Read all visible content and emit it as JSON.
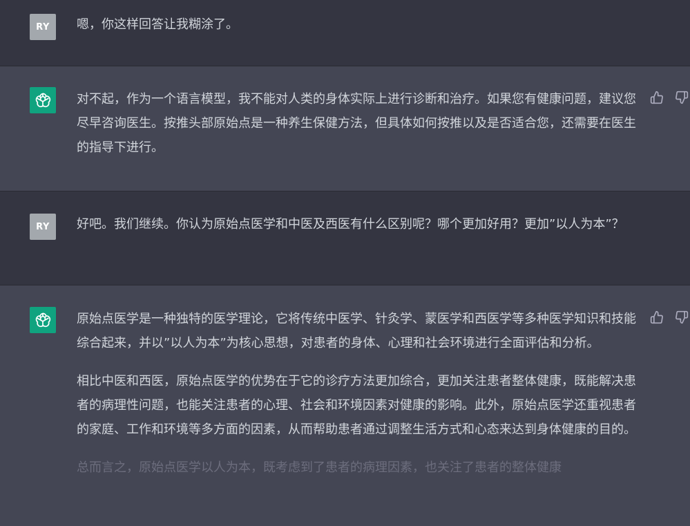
{
  "messages": [
    {
      "role": "user",
      "avatar_text": "RY",
      "paragraphs": [
        "嗯，你这样回答让我糊涂了。"
      ]
    },
    {
      "role": "assistant",
      "avatar_icon": "openai-logo-icon",
      "paragraphs": [
        "对不起，作为一个语言模型，我不能对人类的身体实际上进行诊断和治疗。如果您有健康问题，建议您尽早咨询医生。按推头部原始点是一种养生保健方法，但具体如何按推以及是否适合您，还需要在医生的指导下进行。"
      ]
    },
    {
      "role": "user",
      "avatar_text": "RY",
      "paragraphs": [
        "好吧。我们继续。你认为原始点医学和中医及西医有什么区别呢？哪个更加好用？更加”以人为本”？"
      ]
    },
    {
      "role": "assistant",
      "avatar_icon": "openai-logo-icon",
      "paragraphs": [
        "原始点医学是一种独特的医学理论，它将传统中医学、针灸学、蒙医学和西医学等多种医学知识和技能综合起来，并以”以人为本”为核心思想，对患者的身体、心理和社会环境进行全面评估和分析。",
        "相比中医和西医，原始点医学的优势在于它的诊疗方法更加综合，更加关注患者整体健康，既能解决患者的病理性问题，也能关注患者的心理、社会和环境因素对健康的影响。此外，原始点医学还重视患者的家庭、工作和环境等多方面的因素，从而帮助患者通过调整生活方式和心态来达到身体健康的目的。",
        "总而言之，原始点医学以人为本，既考虑到了患者的病理因素，也关注了患者的整体健康"
      ]
    }
  ],
  "colors": {
    "user_bg": "#343541",
    "assistant_bg": "#444654",
    "text": "#d1d5db",
    "bot_avatar": "#10a37f",
    "user_avatar": "#a3a8ad"
  }
}
